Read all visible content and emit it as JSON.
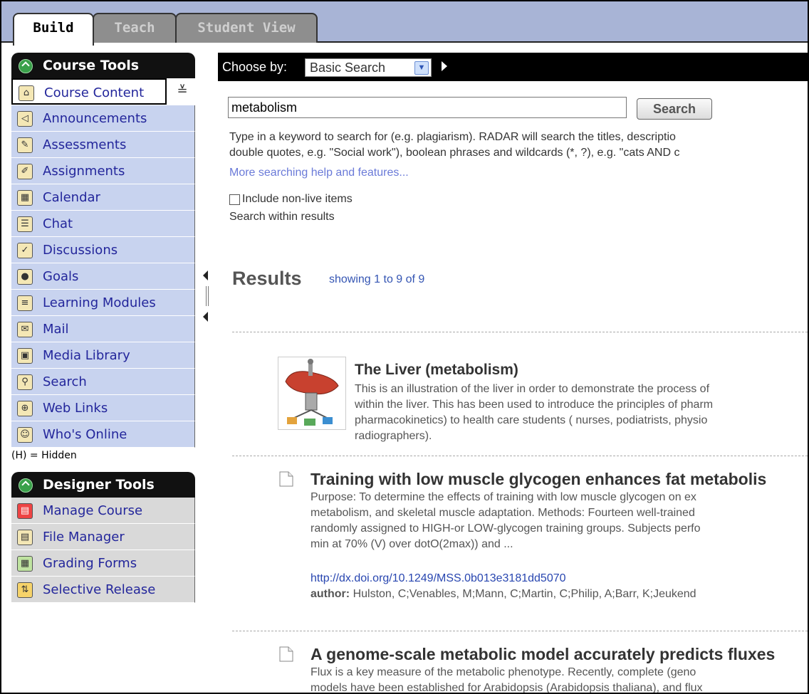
{
  "tabs": [
    {
      "label": "Build",
      "active": true
    },
    {
      "label": "Teach",
      "active": false
    },
    {
      "label": "Student View",
      "active": false
    }
  ],
  "course_tools": {
    "header": "Course Tools",
    "items": [
      {
        "label": "Course Content",
        "icon": "home-icon"
      },
      {
        "label": "Announcements",
        "icon": "megaphone-icon"
      },
      {
        "label": "Assessments",
        "icon": "assessment-icon"
      },
      {
        "label": "Assignments",
        "icon": "assignment-icon"
      },
      {
        "label": "Calendar",
        "icon": "calendar-icon"
      },
      {
        "label": "Chat",
        "icon": "chat-icon"
      },
      {
        "label": "Discussions",
        "icon": "pushpin-icon"
      },
      {
        "label": "Goals",
        "icon": "goals-icon"
      },
      {
        "label": "Learning Modules",
        "icon": "module-icon"
      },
      {
        "label": "Mail",
        "icon": "mail-icon"
      },
      {
        "label": "Media Library",
        "icon": "media-icon"
      },
      {
        "label": "Search",
        "icon": "search-icon"
      },
      {
        "label": "Web Links",
        "icon": "globe-icon"
      },
      {
        "label": "Who's Online",
        "icon": "person-icon"
      }
    ],
    "hidden_note": "(H) = Hidden"
  },
  "designer_tools": {
    "header": "Designer Tools",
    "items": [
      {
        "label": "Manage Course",
        "icon": "toolbox-icon"
      },
      {
        "label": "File Manager",
        "icon": "file-manager-icon"
      },
      {
        "label": "Grading Forms",
        "icon": "grading-icon"
      },
      {
        "label": "Selective Release",
        "icon": "release-icon"
      }
    ]
  },
  "search": {
    "choose_label": "Choose by:",
    "mode": "Basic Search",
    "query": "metabolism",
    "button": "Search",
    "help_line1": "Type in a keyword to search for (e.g. plagiarism). RADAR will search the titles, descriptio",
    "help_line2": "double quotes, e.g. \"Social work\"), boolean phrases and wildcards (*, ?), e.g. \"cats AND c",
    "help_link": "More searching help and features...",
    "include_label": "Include non-live items",
    "within_label": "Search within results"
  },
  "results": {
    "title": "Results",
    "count": "showing 1 to 9 of 9",
    "items": [
      {
        "title": "The Liver (metabolism)",
        "lines": [
          "This is an illustration of the liver in order to demonstrate the process of",
          "within the liver. This has been used to introduce the principles of pharm",
          "pharmacokinetics) to health care students ( nurses, podiatrists, physio",
          "radiographers)."
        ]
      },
      {
        "title": "Training with low muscle glycogen enhances fat metabolis",
        "lines": [
          "Purpose: To determine the effects of training with low muscle glycogen on ex",
          "metabolism, and skeletal muscle adaptation. Methods: Fourteen well-trained",
          "randomly assigned to HIGH-or LOW-glycogen training groups. Subjects perfo",
          "min at 70% (V) over dotO(2max)) and ..."
        ],
        "link": "http://dx.doi.org/10.1249/MSS.0b013e3181dd5070",
        "author_label": "author:",
        "author": "Hulston, C;Venables, M;Mann, C;Martin, C;Philip, A;Barr, K;Jeukend"
      },
      {
        "title": "A genome-scale metabolic model accurately predicts fluxes",
        "lines": [
          "Flux is a key measure of the metabolic phenotype. Recently, complete (geno",
          "models have been established for Arabidopsis (Arabidopsis thaliana), and flux"
        ]
      }
    ]
  },
  "colors": {
    "tab_bar": "#a8b4d6",
    "nav_item": "#c8d3ef",
    "nav_text": "#23269b",
    "designer_item": "#d9d9d9"
  }
}
